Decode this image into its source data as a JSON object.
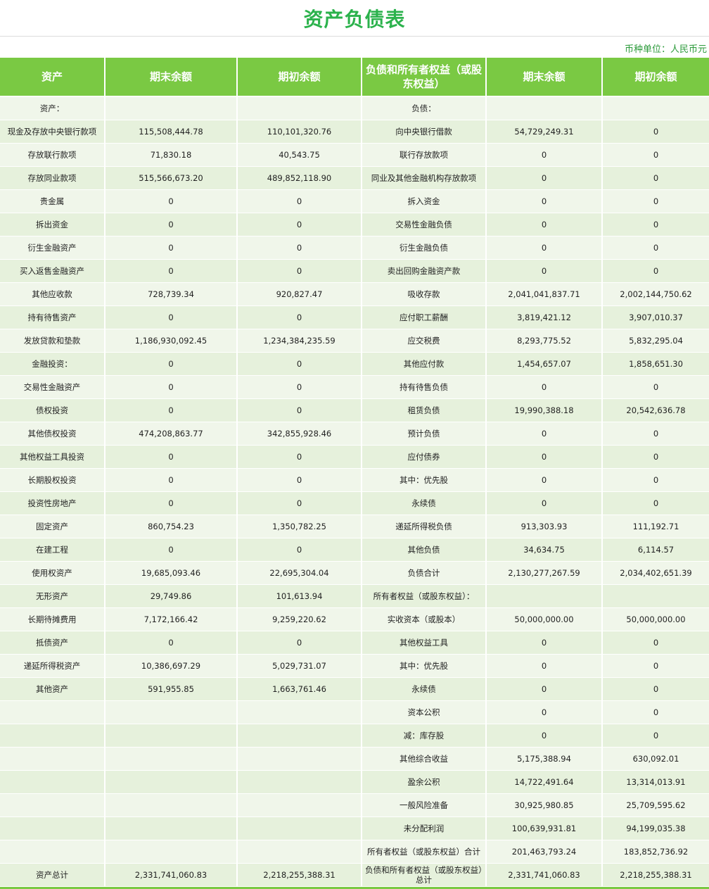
{
  "title": "资产负债表",
  "currency_unit": "币种单位：人民币元",
  "headers": [
    "资产",
    "期末余额",
    "期初余额",
    "负债和所有者权益（或股东权益）",
    "期末余额",
    "期初余额"
  ],
  "rows": [
    [
      "资产：",
      "",
      "",
      "负债：",
      "",
      ""
    ],
    [
      "现金及存放中央银行款项",
      "115,508,444.78",
      "110,101,320.76",
      "向中央银行借款",
      "54,729,249.31",
      "0"
    ],
    [
      "存放联行款项",
      "71,830.18",
      "40,543.75",
      "联行存放款项",
      "0",
      "0"
    ],
    [
      "存放同业款项",
      "515,566,673.20",
      "489,852,118.90",
      "同业及其他金融机构存放款项",
      "0",
      "0"
    ],
    [
      "贵金属",
      "0",
      "0",
      "拆入资金",
      "0",
      "0"
    ],
    [
      "拆出资金",
      "0",
      "0",
      "交易性金融负债",
      "0",
      "0"
    ],
    [
      "衍生金融资产",
      "0",
      "0",
      "衍生金融负债",
      "0",
      "0"
    ],
    [
      "买入返售金融资产",
      "0",
      "0",
      "卖出回购金融资产款",
      "0",
      "0"
    ],
    [
      "其他应收款",
      "728,739.34",
      "920,827.47",
      "吸收存款",
      "2,041,041,837.71",
      "2,002,144,750.62"
    ],
    [
      "持有待售资产",
      "0",
      "0",
      "应付职工薪酬",
      "3,819,421.12",
      "3,907,010.37"
    ],
    [
      "发放贷款和垫款",
      "1,186,930,092.45",
      "1,234,384,235.59",
      "应交税费",
      "8,293,775.52",
      "5,832,295.04"
    ],
    [
      "金融投资：",
      "0",
      "0",
      "其他应付款",
      "1,454,657.07",
      "1,858,651.30"
    ],
    [
      "交易性金融资产",
      "0",
      "0",
      "持有待售负债",
      "0",
      "0"
    ],
    [
      "债权投资",
      "0",
      "0",
      "租赁负债",
      "19,990,388.18",
      "20,542,636.78"
    ],
    [
      "其他债权投资",
      "474,208,863.77",
      "342,855,928.46",
      "预计负债",
      "0",
      "0"
    ],
    [
      "其他权益工具投资",
      "0",
      "0",
      "应付债券",
      "0",
      "0"
    ],
    [
      "长期股权投资",
      "0",
      "0",
      "其中：优先股",
      "0",
      "0"
    ],
    [
      "投资性房地产",
      "0",
      "0",
      "永续债",
      "0",
      "0"
    ],
    [
      "固定资产",
      "860,754.23",
      "1,350,782.25",
      "递延所得税负债",
      "913,303.93",
      "111,192.71"
    ],
    [
      "在建工程",
      "0",
      "0",
      "其他负债",
      "34,634.75",
      "6,114.57"
    ],
    [
      "使用权资产",
      "19,685,093.46",
      "22,695,304.04",
      "负债合计",
      "2,130,277,267.59",
      "2,034,402,651.39"
    ],
    [
      "无形资产",
      "29,749.86",
      "101,613.94",
      "所有者权益（或股东权益）：",
      "",
      ""
    ],
    [
      "长期待摊费用",
      "7,172,166.42",
      "9,259,220.62",
      "实收资本（或股本）",
      "50,000,000.00",
      "50,000,000.00"
    ],
    [
      "抵债资产",
      "0",
      "0",
      "其他权益工具",
      "0",
      "0"
    ],
    [
      "递延所得税资产",
      "10,386,697.29",
      "5,029,731.07",
      "其中：优先股",
      "0",
      "0"
    ],
    [
      "其他资产",
      "591,955.85",
      "1,663,761.46",
      "永续债",
      "0",
      "0"
    ],
    [
      "",
      "",
      "",
      "资本公积",
      "0",
      "0"
    ],
    [
      "",
      "",
      "",
      "减：库存股",
      "0",
      "0"
    ],
    [
      "",
      "",
      "",
      "其他综合收益",
      "5,175,388.94",
      "630,092.01"
    ],
    [
      "",
      "",
      "",
      "盈余公积",
      "14,722,491.64",
      "13,314,013.91"
    ],
    [
      "",
      "",
      "",
      "一般风险准备",
      "30,925,980.85",
      "25,709,595.62"
    ],
    [
      "",
      "",
      "",
      "未分配利润",
      "100,639,931.81",
      "94,199,035.38"
    ],
    [
      "",
      "",
      "",
      "所有者权益（或股东权益）合计",
      "201,463,793.24",
      "183,852,736.92"
    ],
    [
      "资产总计",
      "2,331,741,060.83",
      "2,218,255,388.31",
      "负债和所有者权益（或股东权益）总计",
      "2,331,741,060.83",
      "2,218,255,388.31"
    ]
  ]
}
